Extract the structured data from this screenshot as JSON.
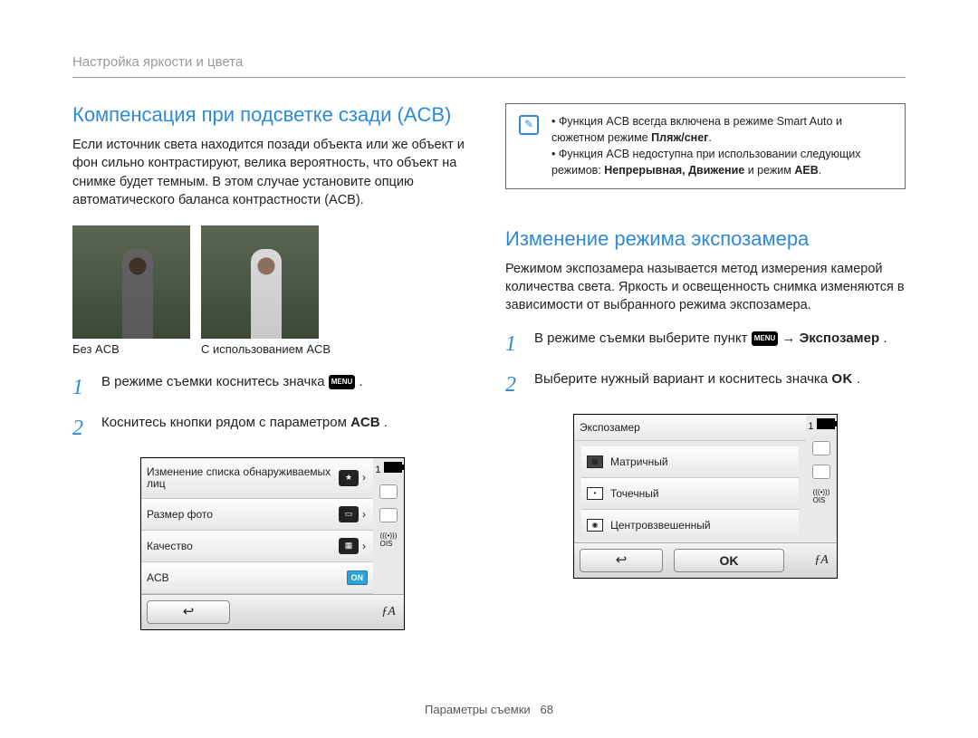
{
  "breadcrumb": "Настройка яркости и цвета",
  "left": {
    "heading": "Компенсация при подсветке сзади (ACB)",
    "intro": "Если источник света находится позади объекта или же объект и фон сильно контрастируют, велика вероятность, что объект на снимке будет темным. В этом случае установите опцию автоматического баланса контрастности (ACB).",
    "caption_without": "Без ACB",
    "caption_with": "С использованием ACB",
    "step1_pre": "В режиме съемки коснитесь значка ",
    "step1_post": ".",
    "menu_badge": "MENU",
    "step2_pre": "Коснитесь кнопки рядом с параметром ",
    "step2_bold": "ACB",
    "step2_post": ".",
    "cam": {
      "row1": "Изменение списка обнаруживаемых лиц",
      "row2": "Размер фото",
      "row3": "Качество",
      "row4": "ACB",
      "on": "ON",
      "top_right": "1",
      "side_ois": "OIS",
      "foot_fa": "ƒA"
    }
  },
  "right": {
    "note1_pre": "Функция ACB всегда включена в режиме Smart Auto и сюжетном режиме ",
    "note1_bold": "Пляж/снег",
    "note1_post": ".",
    "note2_pre": "Функция ACB недоступна при использовании следующих режимов: ",
    "note2_bold": "Непрерывная, Движение",
    "note2_mid": " и режим ",
    "note2_bold2": "AEB",
    "note2_post": ".",
    "heading": "Изменение режима экспозамера",
    "intro": "Режимом экспозамера называется метод измерения камерой количества света. Яркость и освещенность снимка изменяются в зависимости от выбранного режима экспозамера.",
    "step1_pre": "В режиме съемки выберите пункт ",
    "step1_arrow": " → ",
    "step1_bold": "Экспозамер",
    "step1_post": ".",
    "step2_pre": "Выберите нужный вариант и коснитесь значка ",
    "step2_ok": "OK",
    "step2_post": ".",
    "cam": {
      "title": "Экспозамер",
      "opt1": "Матричный",
      "opt2": "Точечный",
      "opt3": "Центровзвешенный",
      "ok": "OK",
      "top_right": "1",
      "side_ois": "OIS",
      "foot_fa": "ƒA"
    }
  },
  "footer_label": "Параметры съемки",
  "footer_page": "68"
}
